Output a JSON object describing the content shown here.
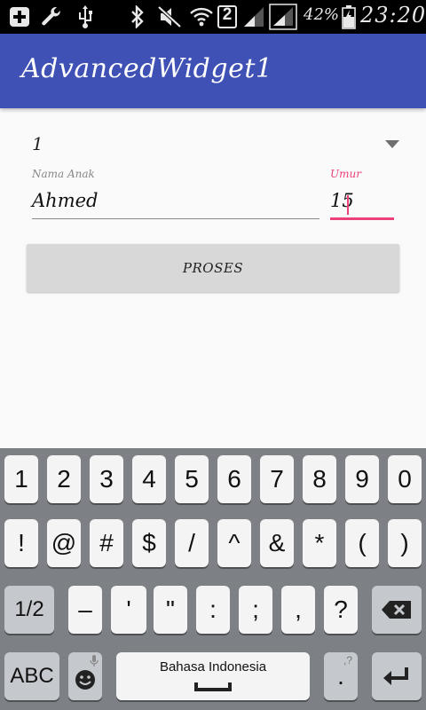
{
  "status_bar": {
    "battery": "42%",
    "time": "23:20",
    "sim_badge": "2",
    "icons": [
      "add-notification-icon",
      "wrench-icon",
      "usb-icon",
      "bluetooth-icon",
      "mute-icon",
      "wifi-icon",
      "sim-2-icon",
      "signal-icon",
      "signal-icon-2",
      "battery-icon"
    ]
  },
  "app_bar": {
    "title": "AdvancedWidget1",
    "color": "#3f51b5"
  },
  "form": {
    "spinner_value": "1",
    "name_label": "Nama Anak",
    "name_value": "Ahmed",
    "age_label": "Umur",
    "age_value": "15",
    "accent_color": "#ec407a",
    "submit_label": "PROSES"
  },
  "keyboard": {
    "row1": [
      "1",
      "2",
      "3",
      "4",
      "5",
      "6",
      "7",
      "8",
      "9",
      "0"
    ],
    "row2": [
      "!",
      "@",
      "#",
      "$",
      "/",
      "^",
      "&",
      "*",
      "(",
      ")"
    ],
    "row3": [
      "1/2",
      "–",
      "'",
      "\"",
      ":",
      ";",
      ",",
      "?"
    ],
    "abc_label": "ABC",
    "space_label": "Bahasa Indonesia",
    "period_label": ".",
    "period_hint": ",?"
  }
}
